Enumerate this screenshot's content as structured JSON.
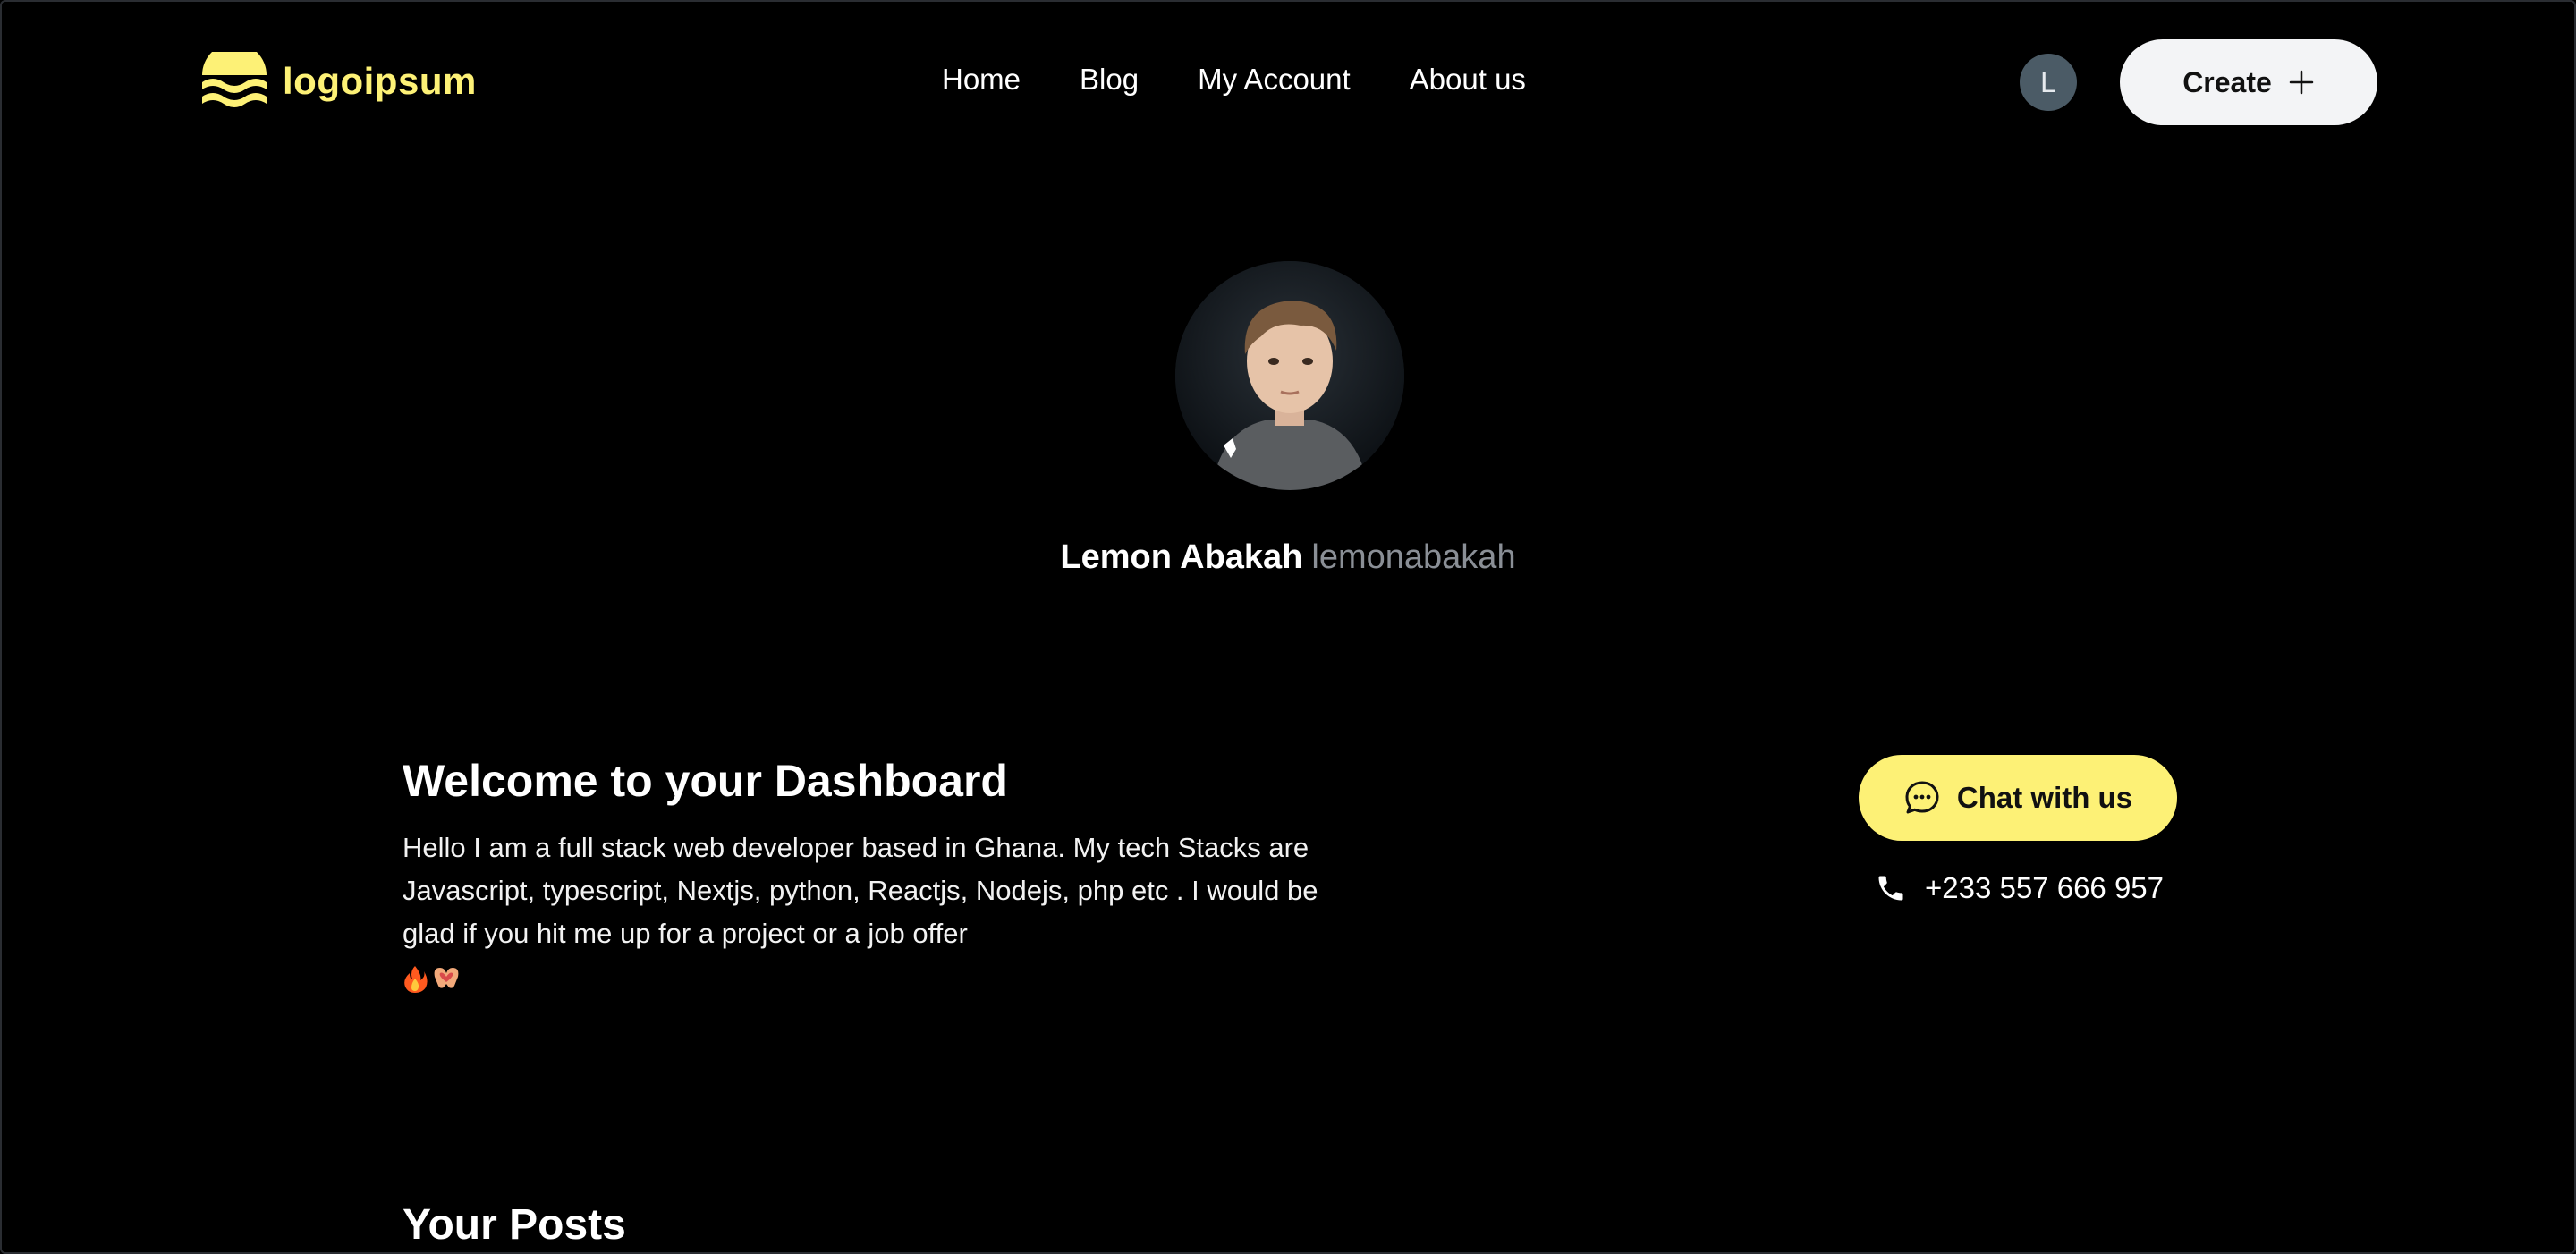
{
  "header": {
    "logo_text": "logoipsum",
    "nav": [
      "Home",
      "Blog",
      "My Account",
      "About us"
    ],
    "avatar_initial": "L",
    "create_label": "Create"
  },
  "profile": {
    "full_name": "Lemon Abakah",
    "username": "lemonabakah"
  },
  "welcome": {
    "title": "Welcome to your Dashboard",
    "bio": "Hello I am a full stack web developer based in Ghana. My tech Stacks are Javascript, typescript, Nextjs, python, Reactjs, Nodejs, php etc . I would be glad if you hit me up for a project or a job offer",
    "emojis": "🔥🫶"
  },
  "contact": {
    "chat_label": "Chat with us",
    "phone": "+233 557 666 957"
  },
  "posts": {
    "title": "Your Posts"
  },
  "colors": {
    "accent": "#fdf176",
    "background": "#000000",
    "muted": "#8a8f96"
  }
}
